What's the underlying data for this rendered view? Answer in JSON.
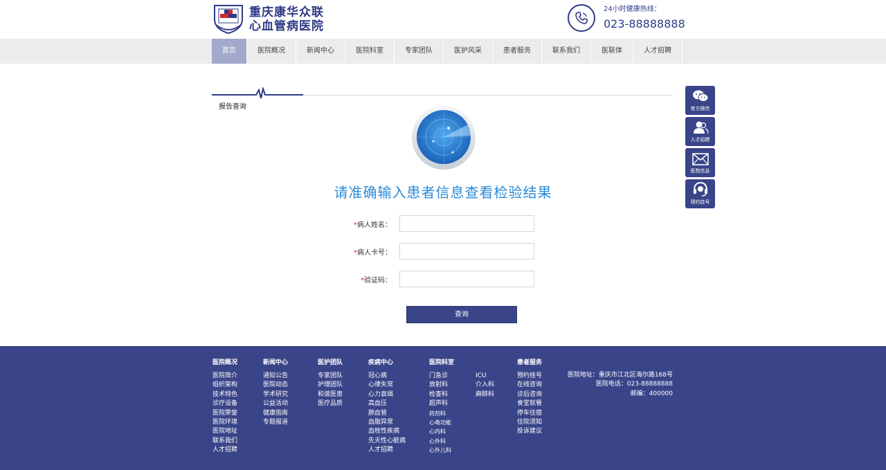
{
  "header": {
    "logo_line1": "重庆康华众联",
    "logo_line2": "心血管病医院",
    "hotline_label": "24小时健康热线：",
    "hotline_number": "023-88888888"
  },
  "nav": {
    "items": [
      "首页",
      "医院概况",
      "新闻中心",
      "医院科室",
      "专家团队",
      "医护风采",
      "患者服务",
      "联系我们",
      "医联体",
      "人才招聘"
    ]
  },
  "section": {
    "title": "报告查询"
  },
  "headline": "请准确输入患者信息查看检验结果",
  "form": {
    "required_mark": "*",
    "name_label": "病人姓名：",
    "card_label": "病人卡号：",
    "code_label": "验证码：",
    "name_value": "",
    "card_value": "",
    "code_value": "",
    "submit_label": "查询"
  },
  "side": {
    "items": [
      {
        "label": "官方微信",
        "icon": "wechat-icon"
      },
      {
        "label": "人才招聘",
        "icon": "users-icon"
      },
      {
        "label": "医院信息",
        "icon": "mail-icon"
      },
      {
        "label": "预约挂号",
        "icon": "headset-icon"
      }
    ]
  },
  "footer": {
    "columns": [
      {
        "title": "医院概况",
        "items": [
          "医院简介",
          "组织架构",
          "技术特色",
          "诊疗设备",
          "医院荣誉",
          "医院环境",
          "医院地址",
          "联系我们",
          "人才招聘"
        ]
      },
      {
        "title": "新闻中心",
        "items": [
          "通知公告",
          "医院动态",
          "学术研究",
          "公益活动",
          "健康指南",
          "专题报道"
        ]
      },
      {
        "title": "医护团队",
        "items": [
          "专家团队",
          "护理团队",
          "和谐医患",
          "医疗品质"
        ]
      },
      {
        "title": "疾病中心",
        "items": [
          "冠心病",
          "心律失常",
          "心力衰竭",
          "高血压",
          "肺血管",
          "血脂异常",
          "血栓性疾病",
          "先天性心脏病",
          "人才招聘"
        ]
      },
      {
        "title": "医院科室",
        "items": [
          "门急诊",
          "放射科",
          "检查科",
          "超声科",
          "药剂科",
          "心电功能",
          "心内科",
          "心外科",
          "心外儿科"
        ]
      },
      {
        "title": "",
        "items": [
          "ICU",
          "介入科",
          "麻醉科"
        ]
      },
      {
        "title": "患者服务",
        "items": [
          "预约挂号",
          "在线咨询",
          "诊后咨询",
          "食堂就餐",
          "停车住宿",
          "住院须知",
          "投诉建议"
        ]
      }
    ],
    "address": "医院地址：重庆市江北区海尔路168号",
    "phone": "医院电话：023-88888888",
    "postcode": "邮编：400000"
  },
  "colors": {
    "brand": "#3a4488",
    "accent": "#2b8ad8",
    "nav_active": "#a2a9cc"
  }
}
